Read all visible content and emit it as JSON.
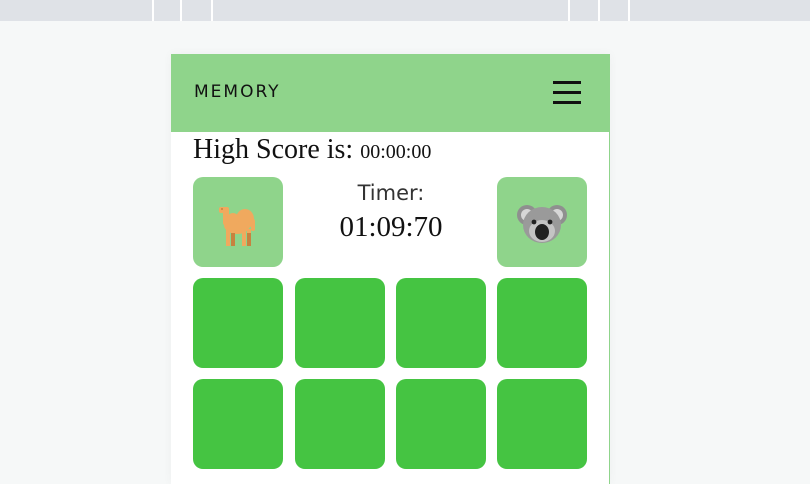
{
  "app": {
    "title": "MEMORY"
  },
  "icons": {
    "menu": "hamburger-menu-icon",
    "player_left": "camel-icon",
    "player_right": "koala-icon"
  },
  "colors": {
    "header": "#8fd48b",
    "tile_face_down": "#45c442",
    "tile_face_up": "#8fd48b"
  },
  "scoreboard": {
    "high_score_label": "High Score is:",
    "high_score_value": "00:00:00",
    "timer_label": "Timer:",
    "timer_value": "01:09:70"
  },
  "grid": {
    "rows": [
      [
        "face-down",
        "face-down",
        "face-down",
        "face-down"
      ],
      [
        "face-down",
        "face-down",
        "face-down",
        "face-down"
      ]
    ]
  }
}
